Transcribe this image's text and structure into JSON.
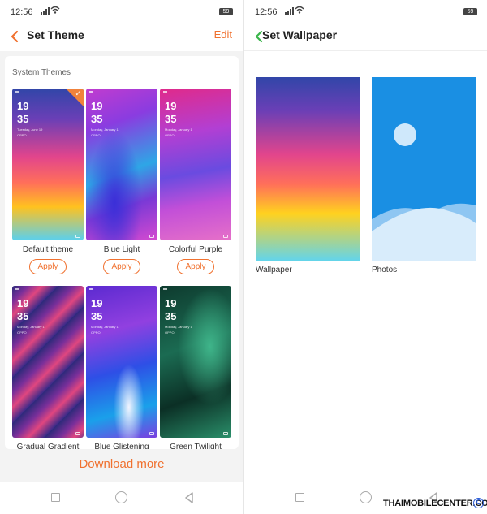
{
  "left": {
    "status": {
      "time": "12:56",
      "battery": "59"
    },
    "title": "Set Theme",
    "edit_label": "Edit",
    "section_label": "System Themes",
    "themes": [
      {
        "name": "Default theme",
        "hour": "19",
        "minute": "35",
        "date": "Tuesday, June 19",
        "brand": "OPPO",
        "apply": "Apply",
        "selected": true
      },
      {
        "name": "Blue Light",
        "hour": "19",
        "minute": "35",
        "date": "Monday, January 1",
        "brand": "OPPO",
        "apply": "Apply"
      },
      {
        "name": "Colorful Purple",
        "hour": "19",
        "minute": "35",
        "date": "Monday, January 1",
        "brand": "OPPO",
        "apply": "Apply"
      },
      {
        "name": "Gradual Gradient",
        "hour": "19",
        "minute": "35",
        "date": "Monday, January 1",
        "brand": "OPPO"
      },
      {
        "name": "Blue Glistening",
        "hour": "19",
        "minute": "35",
        "date": "Monday, January 1",
        "brand": "OPPO"
      },
      {
        "name": "Green Twilight",
        "hour": "19",
        "minute": "35",
        "date": "Monday, January 1",
        "brand": "OPPO"
      }
    ],
    "download_label": "Download more"
  },
  "right": {
    "status": {
      "time": "12:56",
      "battery": "59"
    },
    "title": "Set Wallpaper",
    "tiles": [
      {
        "label": "Wallpaper"
      },
      {
        "label": "Photos"
      }
    ]
  },
  "watermark": "THAIMOBILECENTER.COM",
  "copyright_symbol": "C",
  "colors": {
    "accent": "#f0712f",
    "back_left": "#f0712f",
    "back_right": "#3ab54a"
  }
}
